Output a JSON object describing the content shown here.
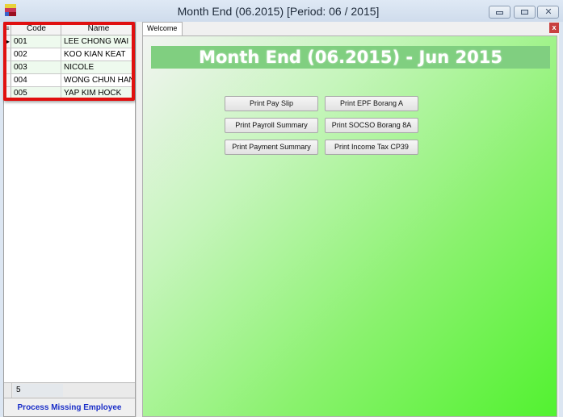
{
  "window": {
    "title": "Month End (06.2015) [Period: 06 / 2015]",
    "controls": [
      "minimize",
      "maximize",
      "close"
    ]
  },
  "employee_grid": {
    "columns": [
      "Code",
      "Name"
    ],
    "header_menu_icon": "≡",
    "current_row_indicator": "▶",
    "rows": [
      {
        "code": "001",
        "name": "LEE CHONG WAI"
      },
      {
        "code": "002",
        "name": "KOO KIAN KEAT"
      },
      {
        "code": "003",
        "name": "NICOLE"
      },
      {
        "code": "004",
        "name": "WONG CHUN HAN"
      },
      {
        "code": "005",
        "name": "YAP KIM HOCK"
      }
    ],
    "footer_count": "5",
    "process_link": "Process Missing Employee"
  },
  "tabs": [
    {
      "label": "Welcome",
      "active": true
    }
  ],
  "tab_close_label": "x",
  "welcome": {
    "banner": "Month End (06.2015) - Jun 2015",
    "buttons": [
      "Print Pay Slip",
      "Print EPF Borang A",
      "Print Payroll Summary",
      "Print SOCSO Borang 8A",
      "Print Payment Summary",
      "Print Income Tax CP39"
    ]
  },
  "colors": {
    "highlight": "#e01010",
    "banner_bg": "#80cf80",
    "link": "#1a2ec8",
    "tab_close": "#c84040"
  }
}
